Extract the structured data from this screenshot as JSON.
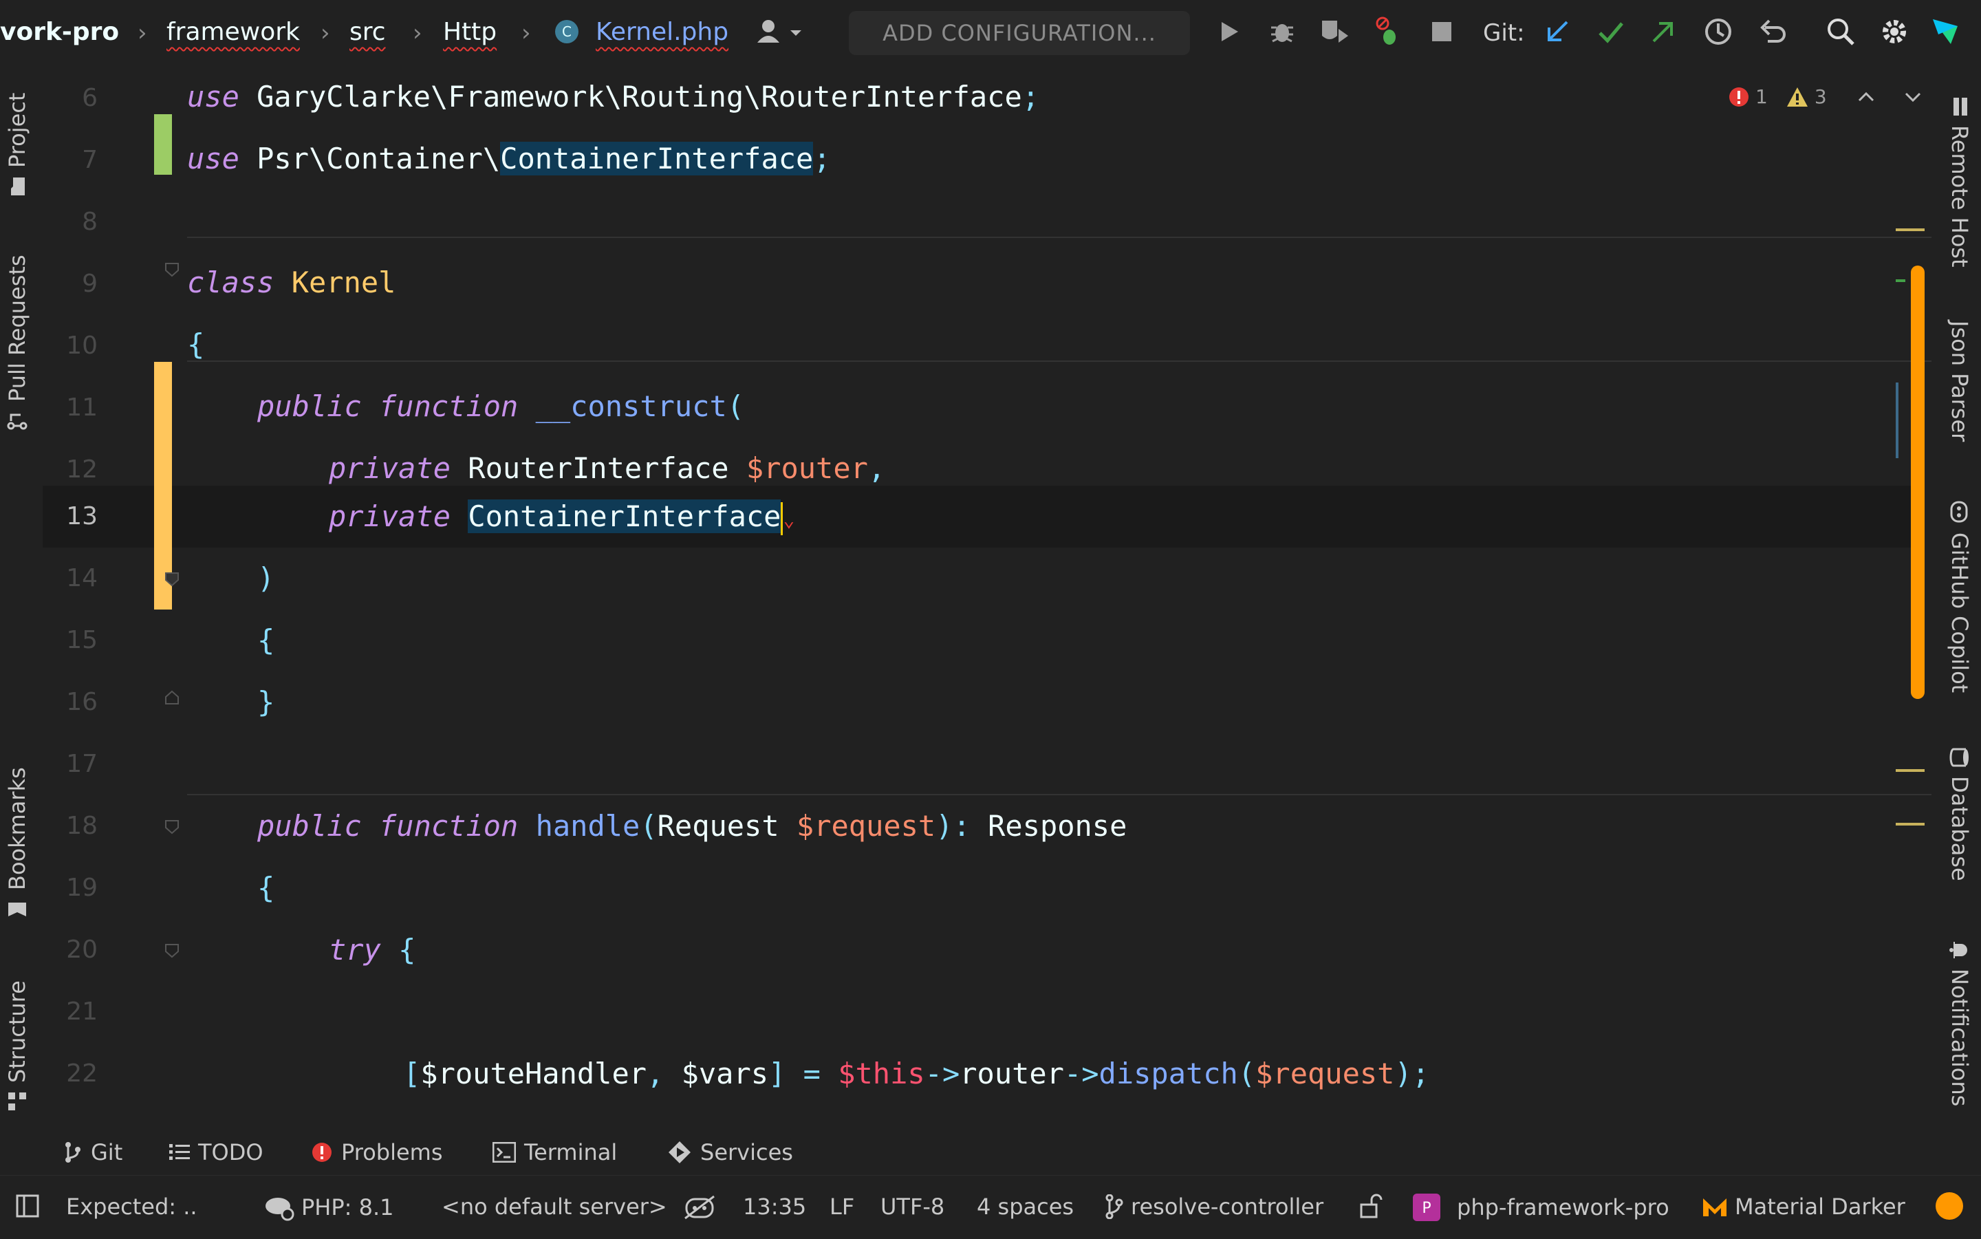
{
  "breadcrumb": {
    "project": "vork-pro",
    "items": [
      "framework",
      "src",
      "Http",
      "Kernel.php"
    ]
  },
  "toolbar": {
    "add_configuration": "ADD CONFIGURATION...",
    "git_label": "Git:"
  },
  "left_tabs": [
    "Project",
    "Pull Requests",
    "Bookmarks",
    "Structure"
  ],
  "right_tabs": [
    "Remote Host",
    "Json Parser",
    "GitHub Copilot",
    "Database",
    "Notifications"
  ],
  "inspections": {
    "errors": "1",
    "warnings": "3"
  },
  "editor": {
    "line_numbers": [
      "6",
      "7",
      "8",
      "9",
      "10",
      "11",
      "12",
      "13",
      "14",
      "15",
      "16",
      "17",
      "18",
      "19",
      "20",
      "21",
      "22"
    ],
    "current_line": "13"
  },
  "bottom_tabs": [
    "Git",
    "TODO",
    "Problems",
    "Terminal",
    "Services"
  ],
  "status": {
    "message": "Expected: ..",
    "php": "PHP: 8.1",
    "server": "<no default server>",
    "position": "13:35",
    "line_sep": "LF",
    "encoding": "UTF-8",
    "indent": "4 spaces",
    "branch": "resolve-controller",
    "project": "php-framework-pro",
    "theme": "Material Darker"
  },
  "colors": {
    "accent": "#ff9800",
    "keyword": "#c792ea",
    "class": "#ffcb6b",
    "function": "#82aaff",
    "variable": "#f78c6c",
    "punctuation": "#89ddff",
    "selection": "#0f3a55"
  }
}
